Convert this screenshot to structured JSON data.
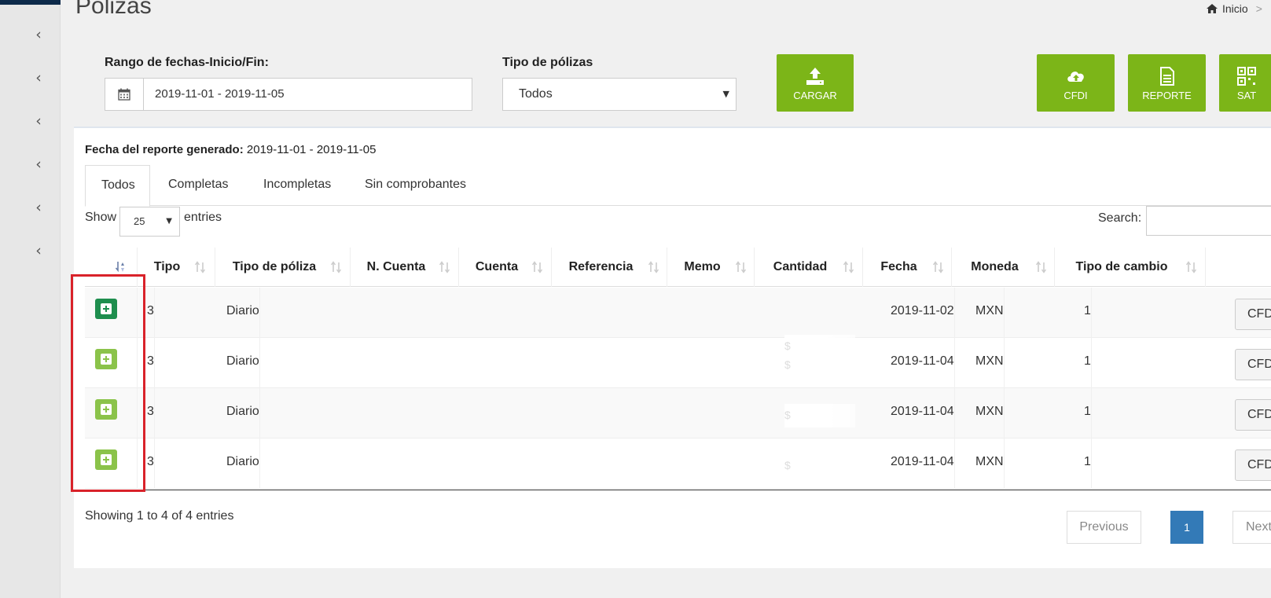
{
  "page": {
    "title": "Pólizas",
    "breadcrumb": {
      "home": "Inicio",
      "sep": ">"
    }
  },
  "filters": {
    "date_label": "Rango de fechas-Inicio/Fin:",
    "date_value": "2019-11-01 - 2019-11-05",
    "type_label": "Tipo de pólizas",
    "type_value": "Todos"
  },
  "actions": {
    "cargar": "CARGAR",
    "cfdi": "CFDI",
    "reporte": "REPORTE",
    "sat": "SAT"
  },
  "report": {
    "generated_label": "Fecha del reporte generado:",
    "generated_value": "2019-11-01 - 2019-11-05"
  },
  "tabs": [
    "Todos",
    "Completas",
    "Incompletas",
    "Sin comprobantes"
  ],
  "table_controls": {
    "show": "Show",
    "length": "25",
    "entries": "entries",
    "search": "Search:"
  },
  "table": {
    "columns": [
      "Tipo",
      "Tipo de póliza",
      "N. Cuenta",
      "Cuenta",
      "Referencia",
      "Memo",
      "Cantidad",
      "Fecha",
      "Moneda",
      "Tipo de cambio"
    ],
    "rows": [
      {
        "tipo": "3",
        "tipo_poliza": "Diario",
        "cantidad": "$",
        "fecha": "2019-11-02",
        "moneda": "MXN",
        "tipo_cambio": "1",
        "action": "CFDI"
      },
      {
        "tipo": "3",
        "tipo_poliza": "Diario",
        "cantidad": "$",
        "fecha": "2019-11-04",
        "moneda": "MXN",
        "tipo_cambio": "1",
        "action": "CFDI"
      },
      {
        "tipo": "3",
        "tipo_poliza": "Diario",
        "cantidad": "$",
        "fecha": "2019-11-04",
        "moneda": "MXN",
        "tipo_cambio": "1",
        "action": "CFDI"
      },
      {
        "tipo": "3",
        "tipo_poliza": "Diario",
        "cantidad": "$",
        "fecha": "2019-11-04",
        "moneda": "MXN",
        "tipo_cambio": "1",
        "action": "CFDI"
      }
    ]
  },
  "footer": {
    "info": "Showing 1 to 4 of 4 entries",
    "previous": "Previous",
    "page": "1",
    "next": "Next"
  },
  "colors": {
    "accent_green": "#7cb518",
    "highlight_red": "#d9222a",
    "page_active_blue": "#337ab7"
  }
}
